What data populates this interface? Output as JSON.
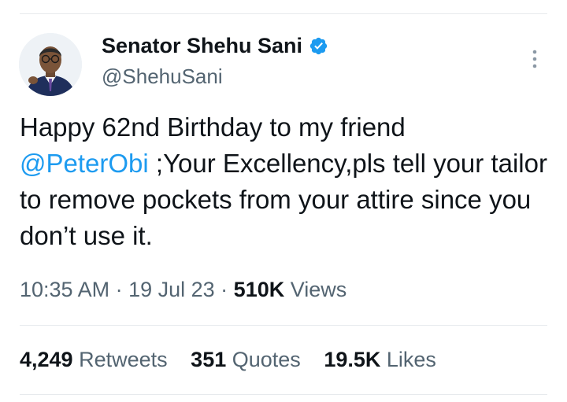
{
  "author": {
    "name": "Senator Shehu Sani",
    "handle": "@ShehuSani",
    "verified_color": "#1d9bf0"
  },
  "tweet": {
    "text_part1": "Happy 62nd Birthday to my friend",
    "mention": "@PeterObi",
    "text_part2": " ;Your Excellency,pls tell your tailor to remove pockets from your attire since you don’t use it."
  },
  "meta": {
    "time": "10:35 AM",
    "separator": " · ",
    "date": "19 Jul 23",
    "views_count": "510K",
    "views_label": " Views"
  },
  "stats": {
    "retweets_count": "4,249",
    "retweets_label": "Retweets",
    "quotes_count": "351",
    "quotes_label": "Quotes",
    "likes_count": "19.5K",
    "likes_label": "Likes"
  },
  "colors": {
    "link": "#1d9bf0",
    "secondary_text": "#536471",
    "primary_text": "#0f1419",
    "divider": "#e7eaed"
  },
  "icons": {
    "verified": "verified-badge-icon",
    "more": "more-options-icon"
  }
}
